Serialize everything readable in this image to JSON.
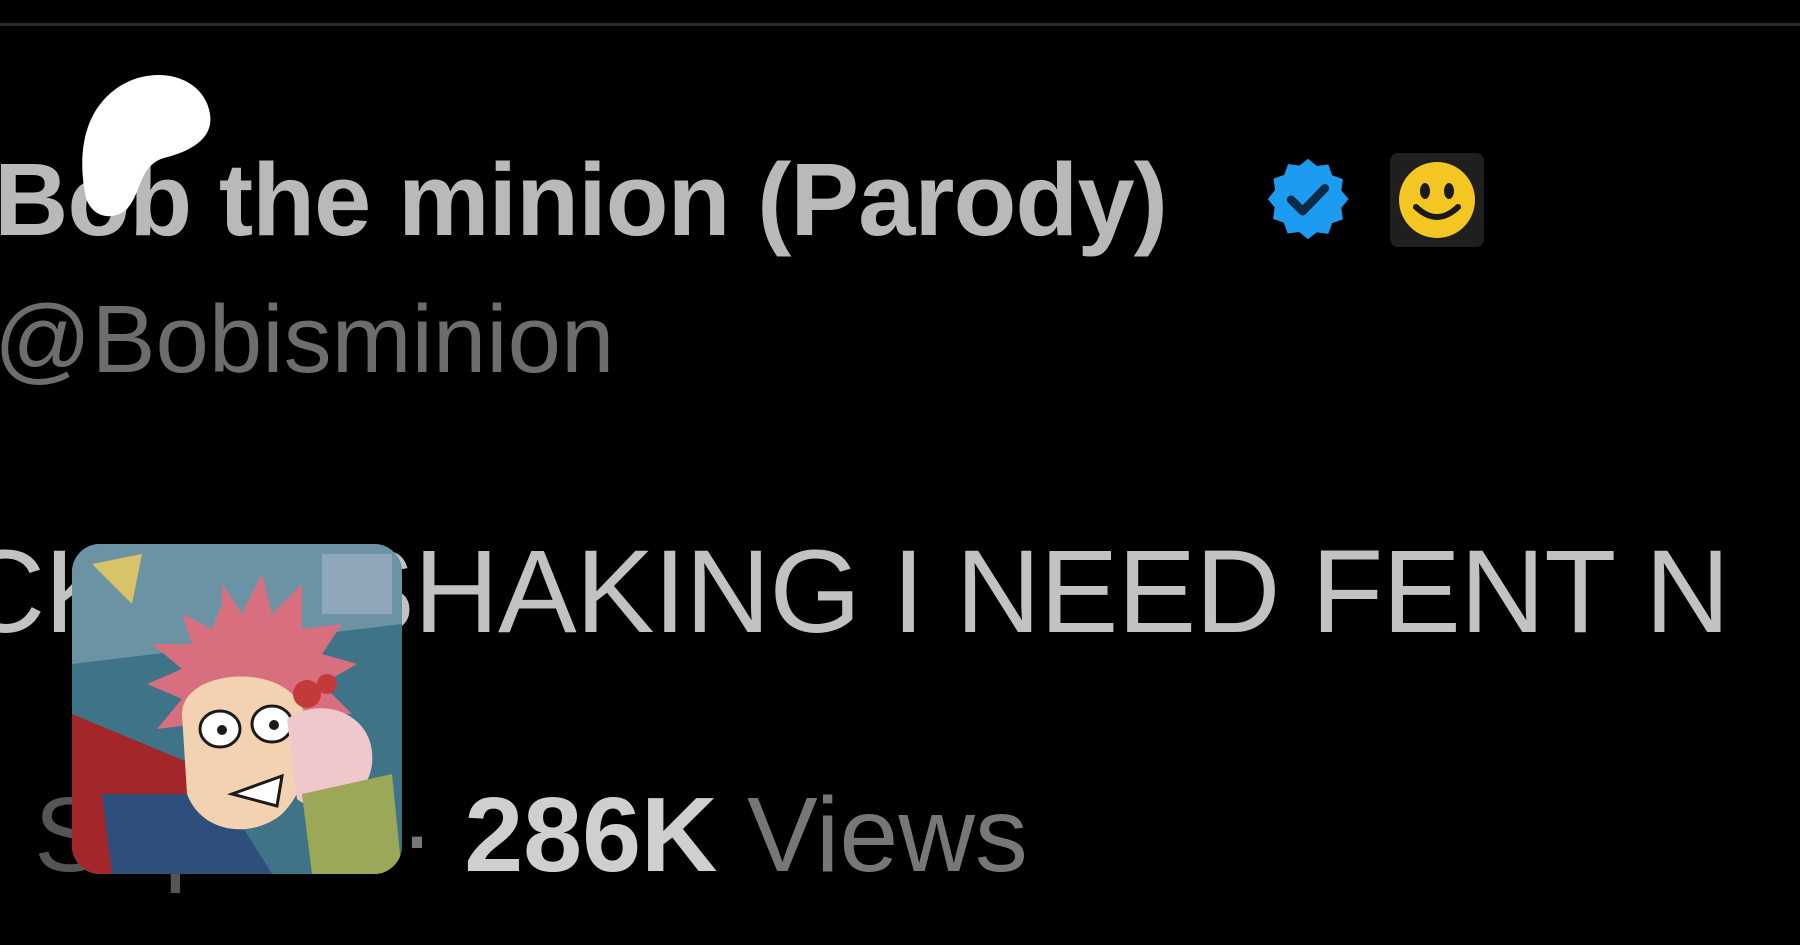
{
  "post": {
    "display_name": "Bob the minion (Parody)",
    "handle": "@Bobisminion",
    "text": "CK I'M SHAKING I NEED FENT N",
    "date": "Sep 21",
    "separator": "·",
    "view_count": "286K",
    "views_label": "Views"
  },
  "badges": {
    "verified_icon": "verified-checkmark-icon",
    "affiliate_icon": "smiley-face-icon"
  },
  "colors": {
    "background": "#000000",
    "verified_blue": "#1d9bf0",
    "smiley_yellow": "#f3c623"
  }
}
